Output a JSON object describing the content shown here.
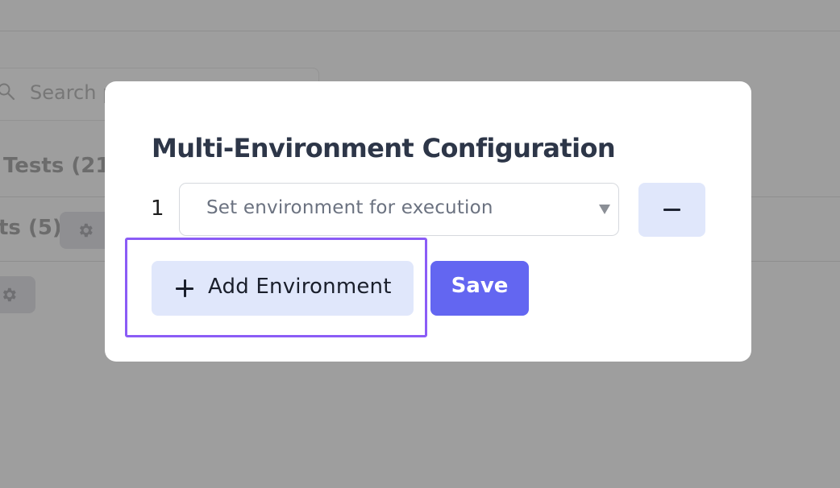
{
  "background": {
    "search": {
      "placeholder": "Search p"
    },
    "tabs": [
      {
        "label": "Tests (21)"
      },
      {
        "label": "ts (5)"
      }
    ]
  },
  "modal": {
    "title": "Multi-Environment Configuration",
    "environments": [
      {
        "index": "1",
        "placeholder": "Set environment for execution"
      }
    ],
    "add_button_label": "Add Environment",
    "save_button_label": "Save"
  },
  "colors": {
    "primary": "#6366f1",
    "secondary_button_bg": "#e0e7fb",
    "highlight": "#8b5cf6",
    "title": "#2d3648",
    "overlay": "#9f9f9f"
  },
  "icons": {
    "background_search": "search-icon",
    "background_settings": "gear-icon",
    "remove": "minus-icon",
    "add": "plus-icon",
    "select": "caret-down-icon"
  }
}
